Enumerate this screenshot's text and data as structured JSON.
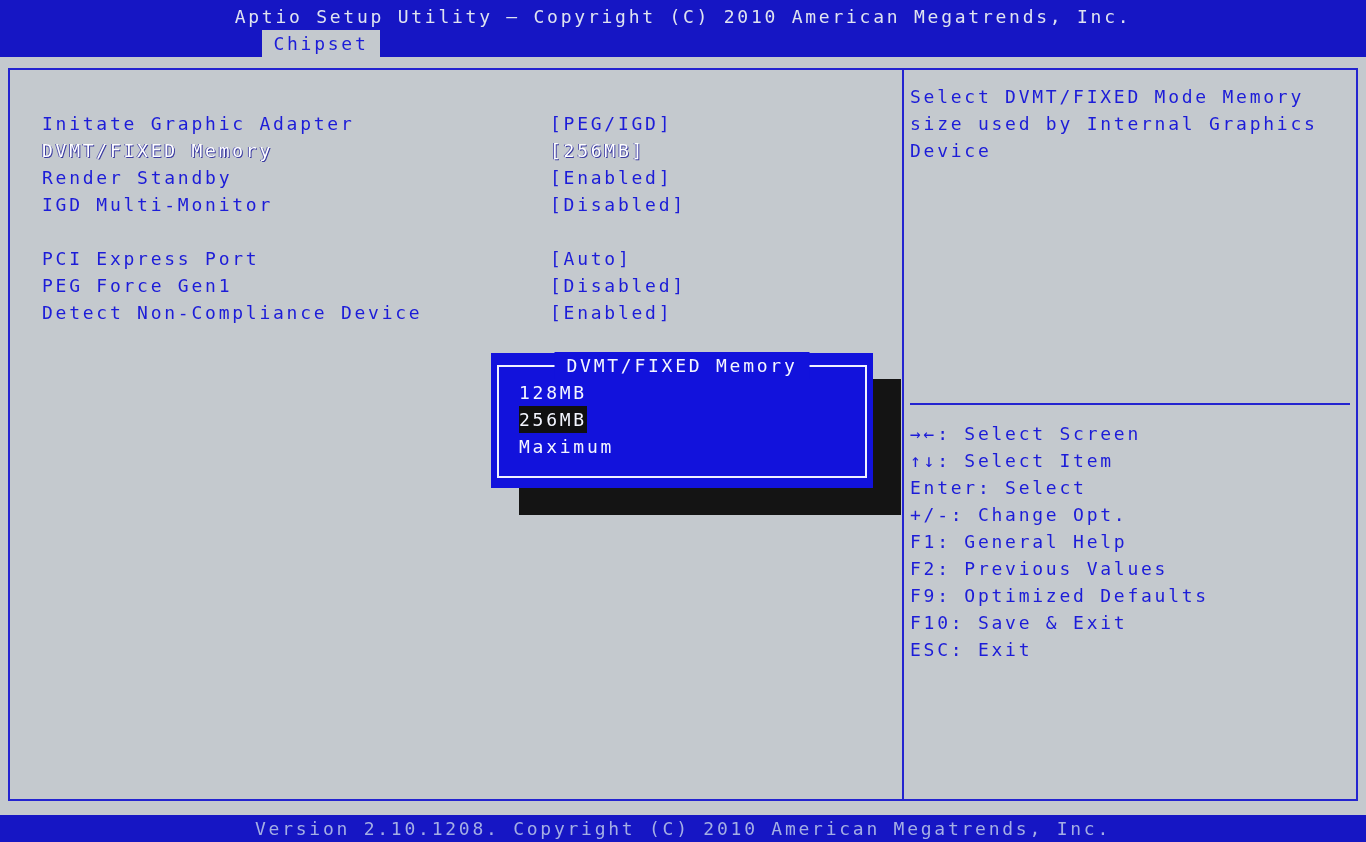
{
  "title": "Aptio Setup Utility – Copyright (C) 2010 American Megatrends, Inc.",
  "tabs": [
    {
      "label": "Chipset",
      "selected": true
    }
  ],
  "settings": [
    [
      {
        "label": "Initate Graphic Adapter",
        "value": "[PEG/IGD]",
        "selected": false
      },
      {
        "label": "DVMT/FIXED Memory",
        "value": "[256MB]",
        "selected": true
      },
      {
        "label": "Render Standby",
        "value": "[Enabled]",
        "selected": false
      },
      {
        "label": "IGD Multi-Monitor",
        "value": "[Disabled]",
        "selected": false
      }
    ],
    [
      {
        "label": "PCI Express Port",
        "value": "[Auto]",
        "selected": false
      },
      {
        "label": "PEG Force Gen1",
        "value": "[Disabled]",
        "selected": false
      },
      {
        "label": "Detect Non-Compliance Device",
        "value": "[Enabled]",
        "selected": false
      }
    ]
  ],
  "popup": {
    "title": "DVMT/FIXED Memory",
    "options": [
      {
        "label": "128MB",
        "selected": false
      },
      {
        "label": "256MB",
        "selected": true
      },
      {
        "label": "Maximum",
        "selected": false
      }
    ]
  },
  "help": "Select DVMT/FIXED Mode Memory size used by Internal Graphics Device",
  "key_hints": [
    "→←: Select Screen",
    "↑↓: Select Item",
    "Enter: Select",
    "+/-: Change Opt.",
    "F1: General Help",
    "F2: Previous Values",
    "F9: Optimized Defaults",
    "F10: Save & Exit",
    "ESC: Exit"
  ],
  "status_bar": "Version 2.10.1208. Copyright (C) 2010 American Megatrends, Inc."
}
